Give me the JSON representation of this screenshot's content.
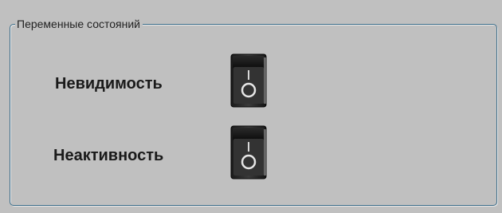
{
  "group": {
    "title": "Переменные состояний"
  },
  "states": [
    {
      "label": "Невидимость",
      "toggle_on": false
    },
    {
      "label": "Неактивность",
      "toggle_on": false
    }
  ],
  "icons": {
    "toggle": "rocker-switch-icon"
  }
}
